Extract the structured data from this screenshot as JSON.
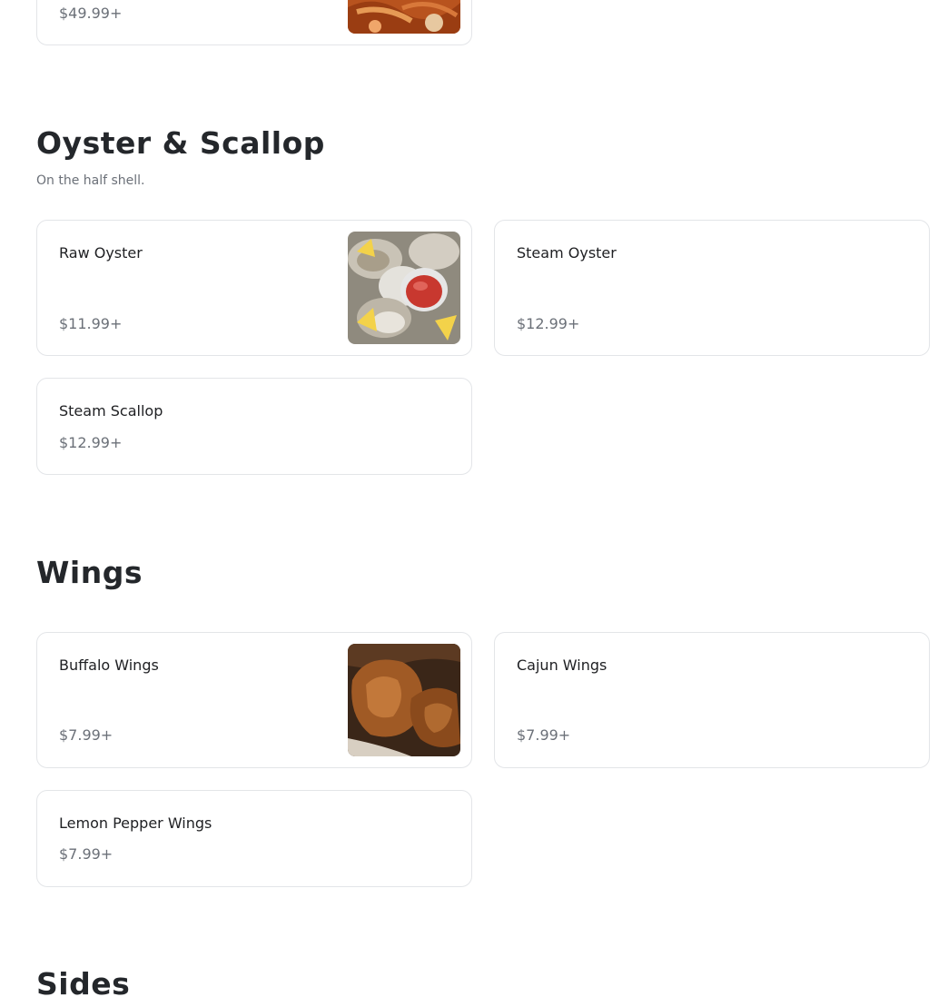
{
  "top_item": {
    "price": "$49.99+",
    "image_icon": "crab-legs-photo"
  },
  "oyster_section": {
    "title": "Oyster & Scallop",
    "description": "On the half shell.",
    "items": [
      {
        "name": "Raw Oyster",
        "price": "$11.99+",
        "image_icon": "raw-oyster-photo"
      },
      {
        "name": "Steam Oyster",
        "price": "$12.99+"
      },
      {
        "name": "Steam Scallop",
        "price": "$12.99+"
      }
    ]
  },
  "wings_section": {
    "title": "Wings",
    "items": [
      {
        "name": "Buffalo Wings",
        "price": "$7.99+",
        "image_icon": "fried-wings-photo"
      },
      {
        "name": "Cajun Wings",
        "price": "$7.99+"
      },
      {
        "name": "Lemon Pepper Wings",
        "price": "$7.99+"
      }
    ]
  },
  "sides_section": {
    "title": "Sides"
  },
  "colors": {
    "text": "#202124",
    "muted": "#6b7078",
    "border": "#e3e5e8",
    "heading": "#24272b"
  }
}
